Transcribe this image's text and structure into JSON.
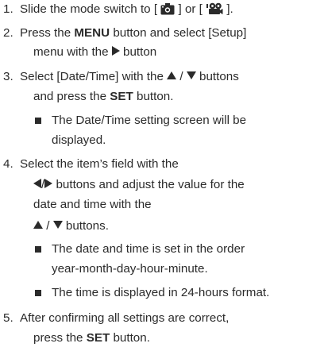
{
  "steps": [
    {
      "num": "1.",
      "text_a": "Slide the mode switch to [ ",
      "text_b": " ] or [ ",
      "text_c": " ]."
    },
    {
      "num": "2.",
      "l1_a": "Press the ",
      "l1_bold": "MENU",
      "l1_b": " button and select [Setup]",
      "l2_a": "menu with the ",
      "l2_b": " button"
    },
    {
      "num": "3.",
      "l1_a": "Select [Date/Time] with the ",
      "l1_sep": " / ",
      "l1_b": " buttons",
      "l2_a": "and press the ",
      "l2_bold": "SET",
      "l2_b": " button.",
      "bullet_l1": "The Date/Time setting screen will be",
      "bullet_l2": "displayed."
    },
    {
      "num": "4.",
      "l1": "Select the item’s field with the",
      "l2_sep": "/",
      "l2_b": " buttons and adjust the value for the",
      "l3": "date and time with the",
      "l4_sep": " / ",
      "l4_b": " buttons.",
      "bullet1_l1": "The date and time is set in the order",
      "bullet1_l2": "year-month-day-hour-minute.",
      "bullet2": "The time is displayed in 24-hours format."
    },
    {
      "num": "5.",
      "l1": "After confirming all settings are correct,",
      "l2_a": "press the ",
      "l2_bold": "SET",
      "l2_b": " button."
    }
  ],
  "icons": {
    "camera_mode": "camera-icon",
    "movie_mode": "movie-camera-icon",
    "arrow_up": "triangle-up-icon",
    "arrow_down": "triangle-down-icon",
    "arrow_left": "triangle-left-icon",
    "arrow_right": "triangle-right-icon",
    "bullet": "square-bullet-icon"
  },
  "colors": {
    "text": "#2b2b2b",
    "background": "#ffffff"
  }
}
